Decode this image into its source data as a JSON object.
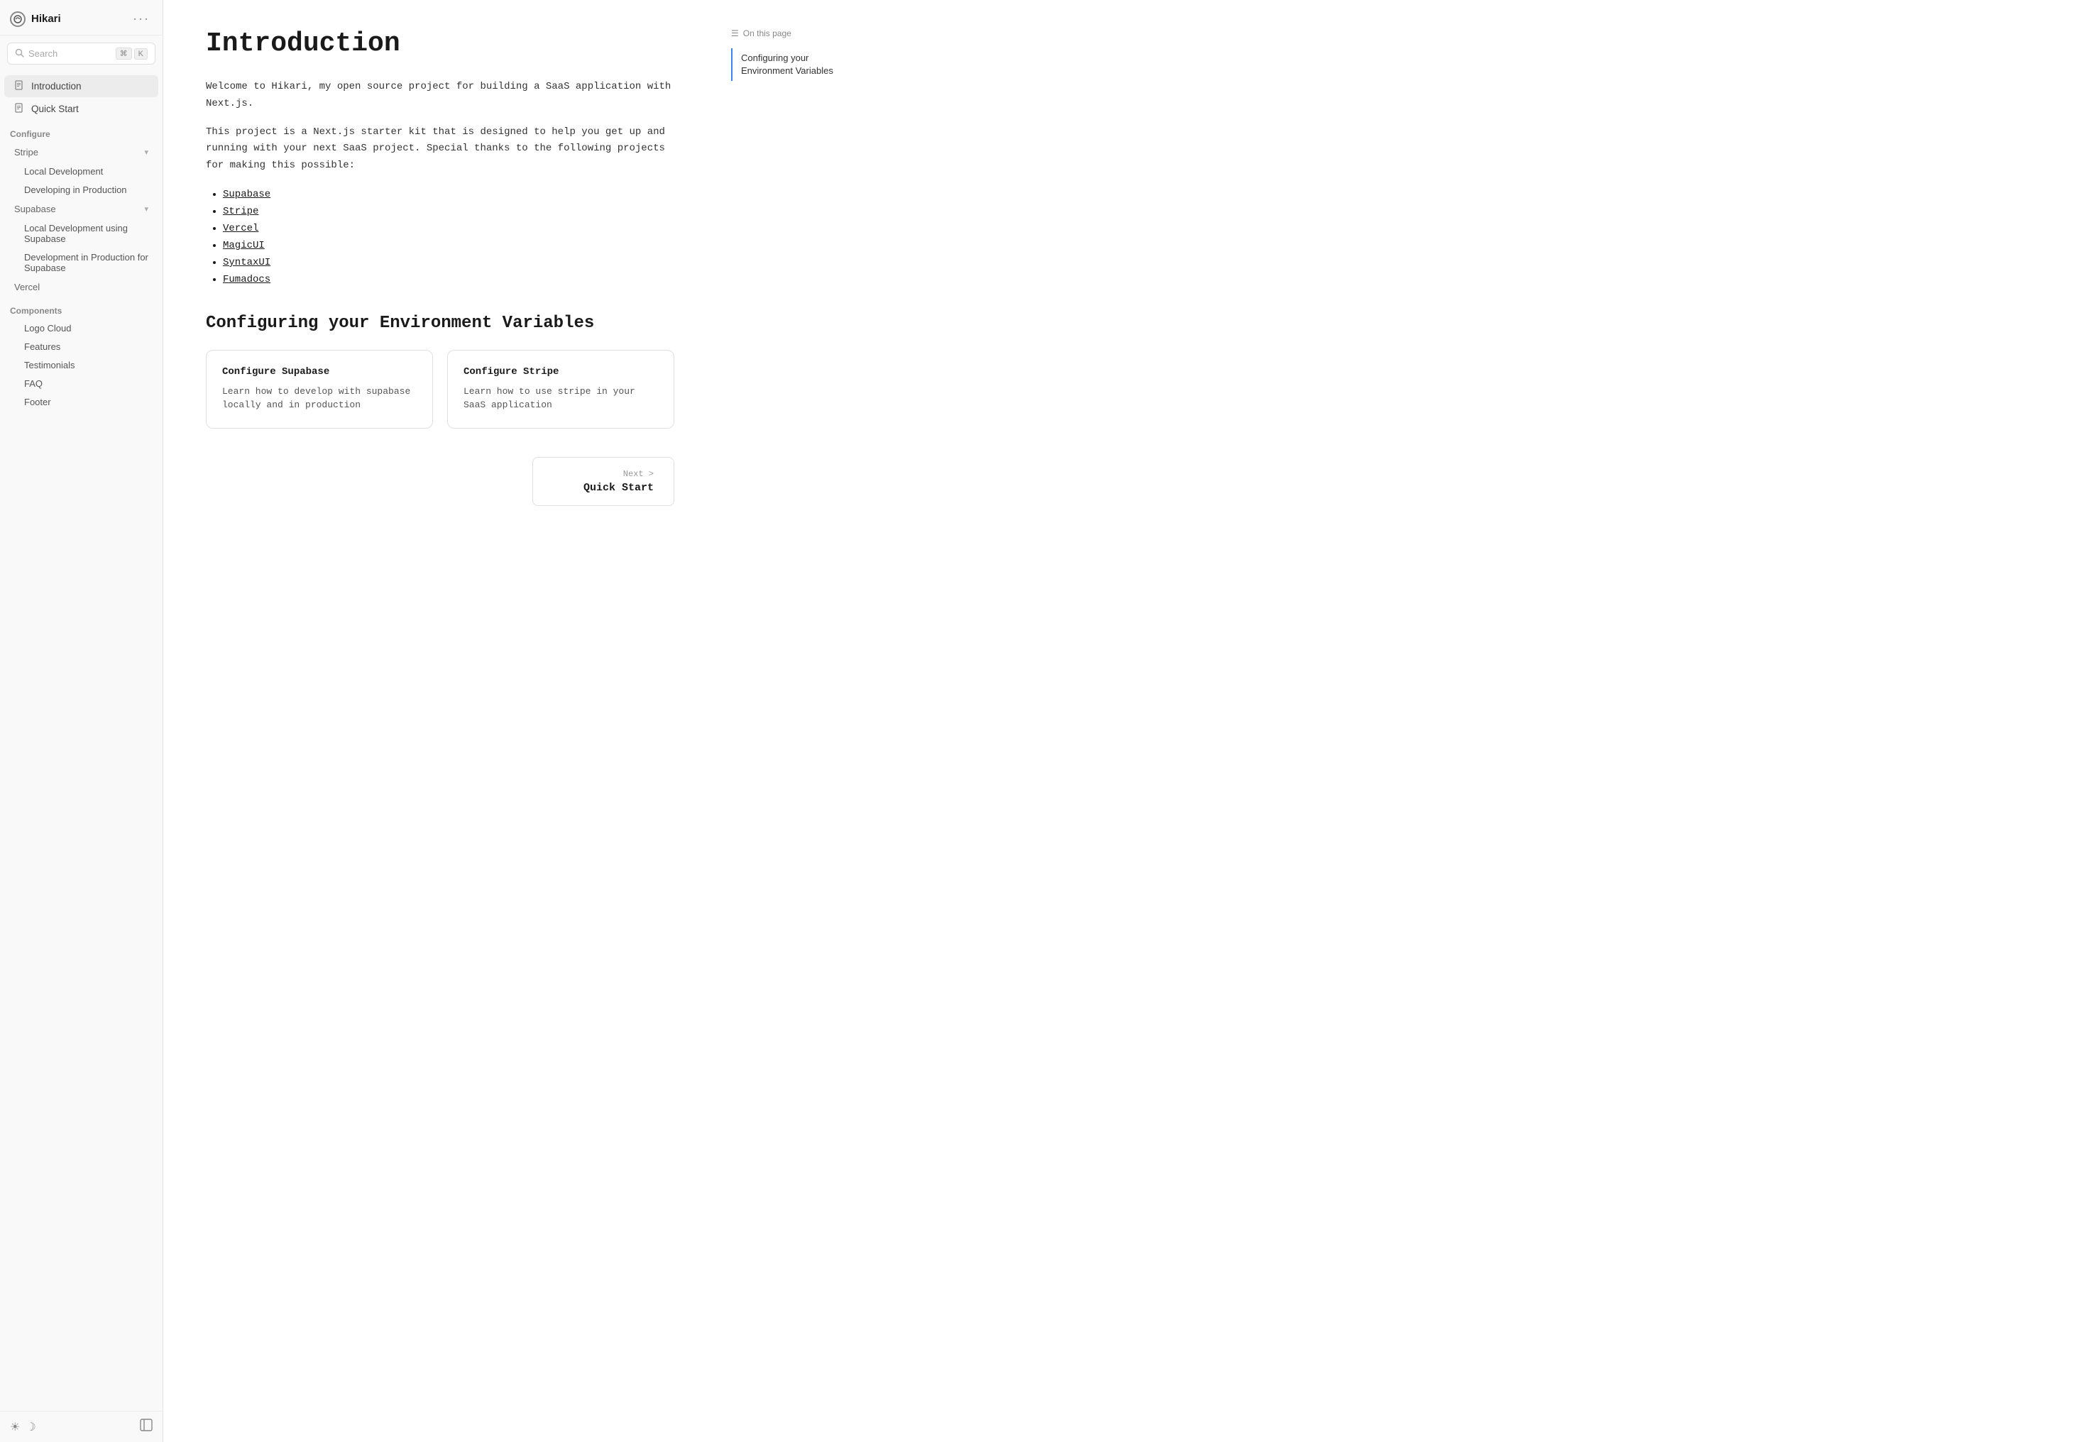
{
  "app": {
    "name": "Hikari"
  },
  "sidebar": {
    "search_placeholder": "Search",
    "search_shortcut_1": "⌘",
    "search_shortcut_2": "K",
    "nav_items": [
      {
        "id": "introduction",
        "label": "Introduction",
        "icon": "📄",
        "active": true
      },
      {
        "id": "quickstart",
        "label": "Quick Start",
        "icon": "📄",
        "active": false
      }
    ],
    "configure_label": "Configure",
    "stripe_label": "Stripe",
    "stripe_sub_items": [
      {
        "id": "local-dev",
        "label": "Local Development"
      },
      {
        "id": "dev-in-prod",
        "label": "Developing in Production"
      }
    ],
    "supabase_label": "Supabase",
    "supabase_sub_items": [
      {
        "id": "local-dev-supabase",
        "label": "Local Development using Supabase"
      },
      {
        "id": "dev-prod-supabase",
        "label": "Development in Production for Supabase"
      }
    ],
    "vercel_label": "Vercel",
    "components_label": "Components",
    "components_items": [
      {
        "id": "logo-cloud",
        "label": "Logo Cloud"
      },
      {
        "id": "features",
        "label": "Features"
      },
      {
        "id": "testimonials",
        "label": "Testimonials"
      },
      {
        "id": "faq",
        "label": "FAQ"
      },
      {
        "id": "footer",
        "label": "Footer"
      }
    ]
  },
  "main": {
    "title": "Introduction",
    "intro_paragraph_1": "Welcome to Hikari, my open source project for building a SaaS application with Next.js.",
    "intro_paragraph_2": "This project is a Next.js starter kit that is designed to help you get up and running with your next SaaS project. Special thanks to the following projects for making this possible:",
    "links": [
      {
        "id": "supabase",
        "label": "Supabase"
      },
      {
        "id": "stripe",
        "label": "Stripe"
      },
      {
        "id": "vercel",
        "label": "Vercel"
      },
      {
        "id": "magicui",
        "label": "MagicUI"
      },
      {
        "id": "syntaxui",
        "label": "SyntaxUI"
      },
      {
        "id": "fumadocs",
        "label": "Fumadocs"
      }
    ],
    "env_section_title": "Configuring your Environment Variables",
    "cards": [
      {
        "id": "configure-supabase",
        "title": "Configure Supabase",
        "description": "Learn how to develop with supabase locally and in production"
      },
      {
        "id": "configure-stripe",
        "title": "Configure Stripe",
        "description": "Learn how to use stripe in your SaaS application"
      }
    ],
    "next_label": "Next >",
    "next_title": "Quick Start"
  },
  "toc": {
    "header": "On this page",
    "items": [
      {
        "id": "env-vars",
        "label": "Configuring your Environment Variables"
      }
    ]
  }
}
